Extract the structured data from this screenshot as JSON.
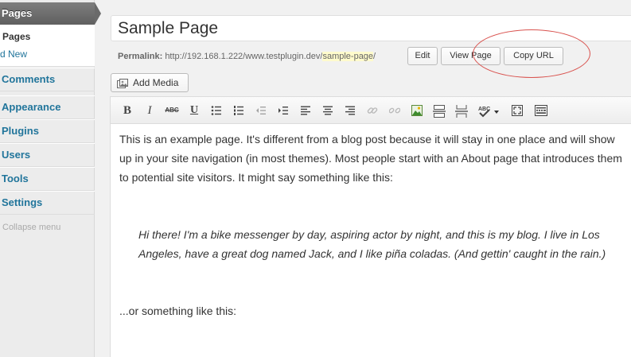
{
  "sidebar": {
    "current_menu": "Pages",
    "submenu": {
      "pages": "Pages",
      "add_new": "d New"
    },
    "items": [
      "Comments",
      "Appearance",
      "Plugins",
      "Users",
      "Tools",
      "Settings"
    ],
    "collapse": "Collapse menu"
  },
  "post": {
    "title": "Sample Page",
    "permalink_label": "Permalink:",
    "permalink_base": "http://192.168.1.222/www.testplugin.dev/",
    "permalink_slug": "sample-page",
    "permalink_trail": "/",
    "edit_button": "Edit",
    "view_button": "View Page",
    "copy_button": "Copy URL"
  },
  "media": {
    "add_label": "Add Media"
  },
  "toolbar": {
    "bold": "B",
    "italic": "I",
    "strike": "ABC",
    "underline": "U"
  },
  "content": {
    "para1": "This is an example page. It's different from a blog post because it will stay in one place and will show up in your site navigation (in most themes). Most people start with an About page that introduces them to potential site visitors. It might say something like this:",
    "quote": "Hi there! I'm a bike messenger by day, aspiring actor by night, and this is my blog. I live in Los Angeles, have a great dog named Jack, and I like piña coladas. (And gettin' caught in the rain.)",
    "para2": "...or something like this:"
  },
  "colors": {
    "link": "#21759b",
    "annotation": "#d9534f",
    "slug_highlight": "#fffbcc"
  },
  "icons": [
    "add-media-icon",
    "bullet-list-icon",
    "numbered-list-icon",
    "outdent-icon",
    "indent-icon",
    "align-left-icon",
    "align-center-icon",
    "align-right-icon",
    "link-icon",
    "unlink-icon",
    "insert-image-icon",
    "read-more-icon",
    "page-break-icon",
    "spellcheck-icon",
    "fullscreen-icon",
    "kitchen-sink-icon"
  ]
}
